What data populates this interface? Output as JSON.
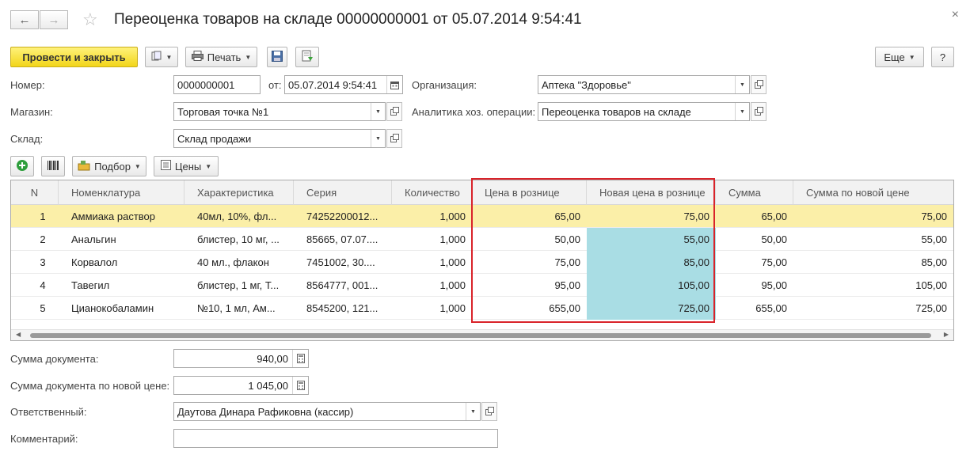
{
  "header": {
    "title": "Переоценка товаров на складе 00000000001 от 05.07.2014 9:54:41",
    "close_glyph": "×"
  },
  "toolbar": {
    "post_close_label": "Провести и закрыть",
    "print_label": "Печать",
    "more_label": "Еще",
    "help_label": "?"
  },
  "form": {
    "number_label": "Номер:",
    "number_value": "0000000001",
    "from_label": "от:",
    "date_value": "05.07.2014  9:54:41",
    "org_label": "Организация:",
    "org_value": "Аптека \"Здоровье\"",
    "shop_label": "Магазин:",
    "shop_value": "Торговая точка №1",
    "analytics_label": "Аналитика хоз. операции:",
    "analytics_value": "Переоценка товаров на складе",
    "warehouse_label": "Склад:",
    "warehouse_value": "Склад продажи"
  },
  "table_toolbar": {
    "pick_label": "Подбор",
    "prices_label": "Цены"
  },
  "table": {
    "columns": [
      "N",
      "Номенклатура",
      "Характеристика",
      "Серия",
      "Количество",
      "Цена в рознице",
      "Новая цена в рознице",
      "Сумма",
      "Сумма по новой цене"
    ],
    "rows": [
      {
        "n": "1",
        "item": "Аммиака раствор",
        "char": "40мл, 10%, фл...",
        "series": "74252200012...",
        "qty": "1,000",
        "price": "65,00",
        "new_price": "75,00",
        "sum": "65,00",
        "new_sum": "75,00",
        "selected": true
      },
      {
        "n": "2",
        "item": "Анальгин",
        "char": "блистер, 10 мг, ...",
        "series": "85665, 07.07....",
        "qty": "1,000",
        "price": "50,00",
        "new_price": "55,00",
        "sum": "50,00",
        "new_sum": "55,00",
        "selected": false
      },
      {
        "n": "3",
        "item": "Корвалол",
        "char": "40 мл., флакон",
        "series": "7451002, 30....",
        "qty": "1,000",
        "price": "75,00",
        "new_price": "85,00",
        "sum": "75,00",
        "new_sum": "85,00",
        "selected": false
      },
      {
        "n": "4",
        "item": "Тавегил",
        "char": "блистер, 1 мг, Т...",
        "series": "8564777, 001...",
        "qty": "1,000",
        "price": "95,00",
        "new_price": "105,00",
        "sum": "95,00",
        "new_sum": "105,00",
        "selected": false
      },
      {
        "n": "5",
        "item": "Цианокобаламин",
        "char": "№10, 1 мл, Ам...",
        "series": "8545200, 121...",
        "qty": "1,000",
        "price": "655,00",
        "new_price": "725,00",
        "sum": "655,00",
        "new_sum": "725,00",
        "selected": false
      }
    ]
  },
  "footer": {
    "doc_sum_label": "Сумма документа:",
    "doc_sum_value": "940,00",
    "doc_sum_new_label": "Сумма документа по новой цене:",
    "doc_sum_new_value": "1 045,00",
    "responsible_label": "Ответственный:",
    "responsible_value": "Даутова Динара Рафиковна (кассир)",
    "comment_label": "Комментарий:",
    "comment_value": ""
  },
  "colors": {
    "primary_button": "#f2d51a",
    "selected_row": "#fbefa8",
    "highlight_cell": "#a9dde4",
    "annotation_box": "#d9232a"
  }
}
